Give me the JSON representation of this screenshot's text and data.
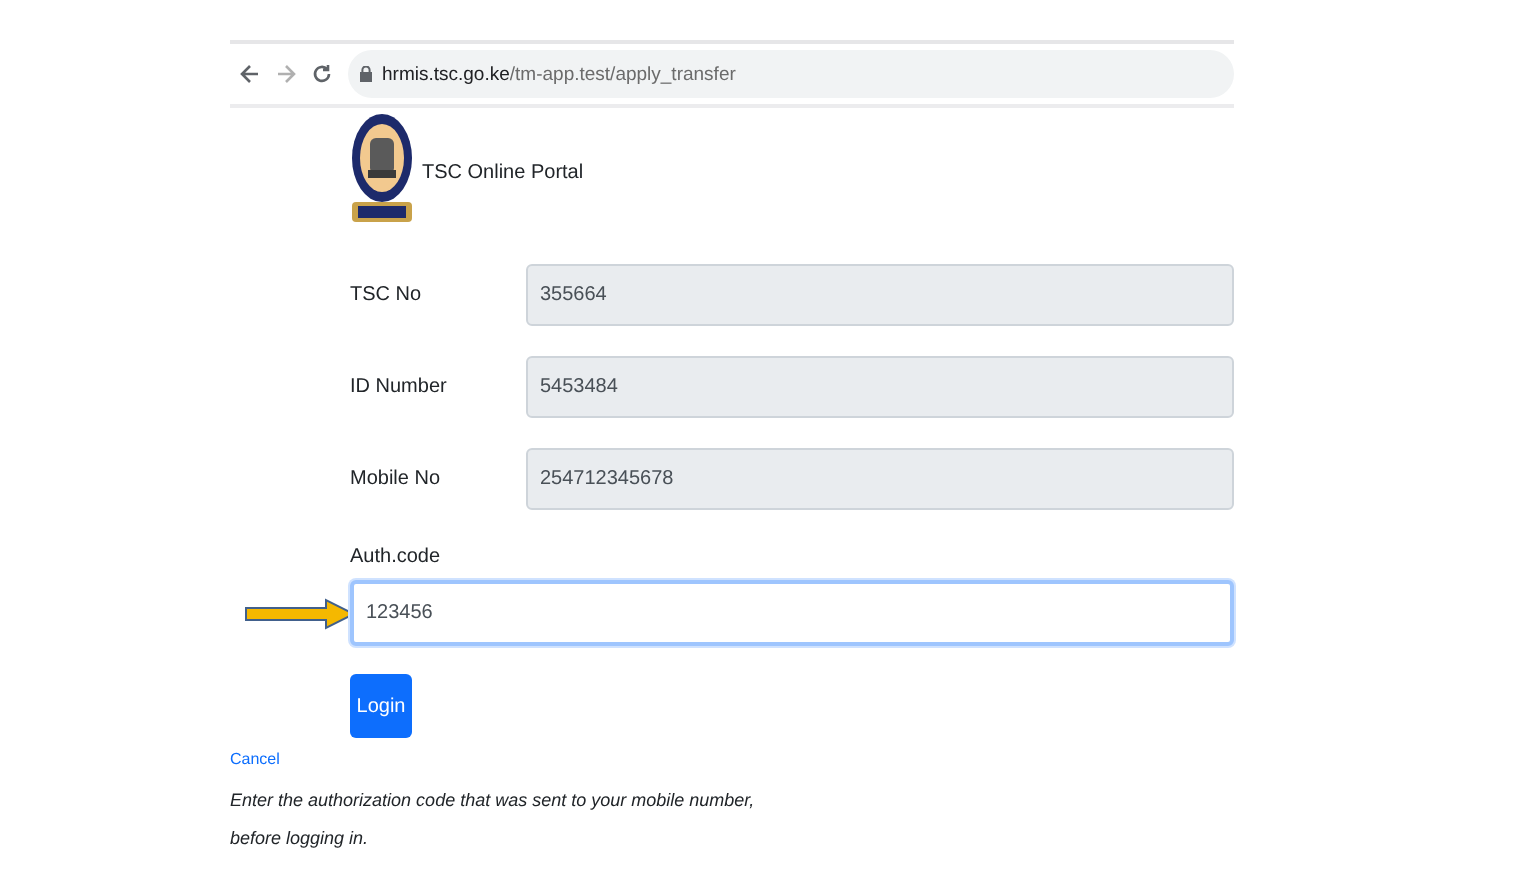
{
  "browser": {
    "url_host": "hrmis.tsc.go.ke",
    "url_path": "/tm-app.test/apply_transfer"
  },
  "header": {
    "title": "TSC Online Portal"
  },
  "fields": [
    {
      "label": "TSC No",
      "value": "355664",
      "disabled": true,
      "focused": false
    },
    {
      "label": "ID Number",
      "value": "5453484",
      "disabled": true,
      "focused": false
    },
    {
      "label": "Mobile No",
      "value": "254712345678",
      "disabled": true,
      "focused": false
    }
  ],
  "auth": {
    "label": "Auth.code",
    "value": "123456",
    "disabled": false,
    "focused": true
  },
  "login_button": "Login",
  "cancel_link": "Cancel",
  "help_lines": [
    "Enter the authorization code that was sent to your mobile number,",
    "before logging in."
  ]
}
